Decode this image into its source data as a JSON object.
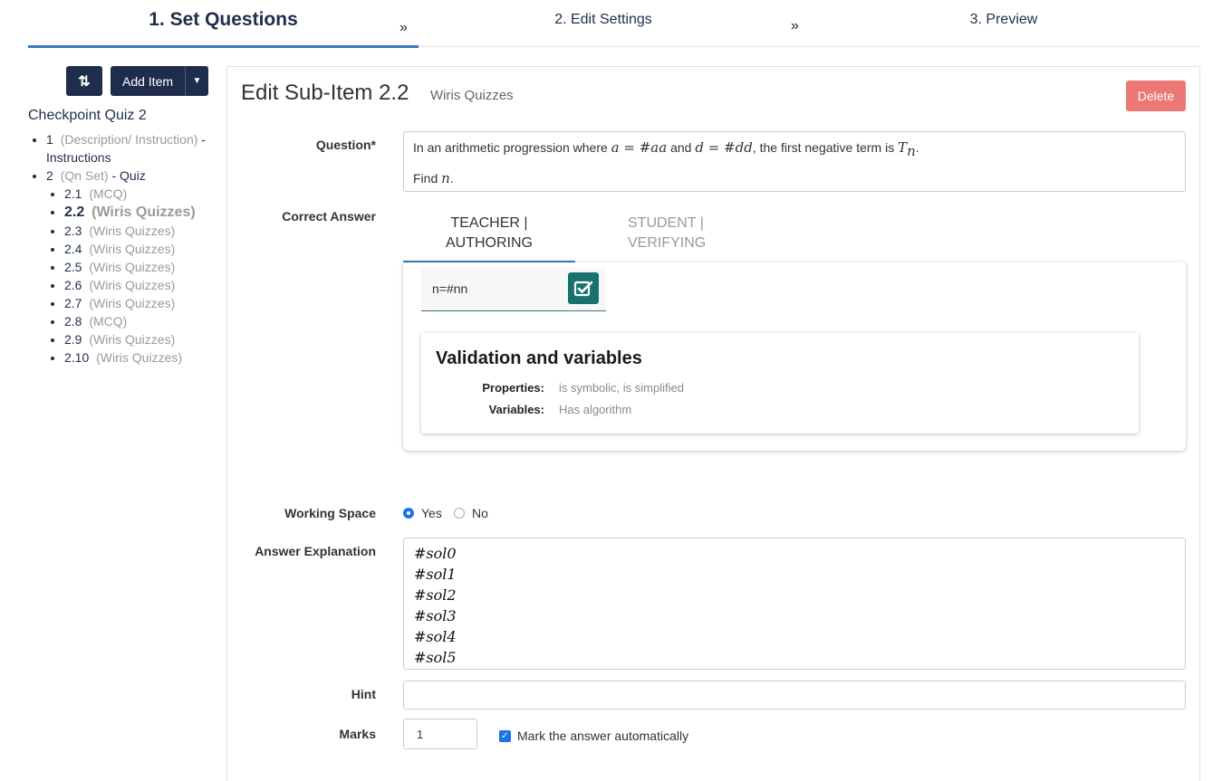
{
  "steps": [
    {
      "label": "1. Set Questions"
    },
    {
      "label": "2. Edit Settings"
    },
    {
      "label": "3. Preview"
    }
  ],
  "step_separator": "»",
  "sidebar": {
    "sort_icon": "sort-arrows-icon",
    "sort_glyph": "⇅",
    "add_item_label": "Add Item",
    "quiz_title": "Checkpoint Quiz 2",
    "items": [
      {
        "num": "1",
        "type": "(Description/ Instruction)",
        "suffix": "- Instructions"
      },
      {
        "num": "2",
        "type": "(Qn Set)",
        "suffix": "- Quiz"
      }
    ],
    "sub_items": [
      {
        "num": "2.1",
        "type": "(MCQ)"
      },
      {
        "num": "2.2",
        "type": "(Wiris Quizzes)"
      },
      {
        "num": "2.3",
        "type": "(Wiris Quizzes)"
      },
      {
        "num": "2.4",
        "type": "(Wiris Quizzes)"
      },
      {
        "num": "2.5",
        "type": "(Wiris Quizzes)"
      },
      {
        "num": "2.6",
        "type": "(Wiris Quizzes)"
      },
      {
        "num": "2.7",
        "type": "(Wiris Quizzes)"
      },
      {
        "num": "2.8",
        "type": "(MCQ)"
      },
      {
        "num": "2.9",
        "type": "(Wiris Quizzes)"
      },
      {
        "num": "2.10",
        "type": "(Wiris Quizzes)"
      }
    ]
  },
  "editor": {
    "title": "Edit Sub-Item 2.2",
    "subtitle": "Wiris Quizzes",
    "delete_label": "Delete",
    "question_label": "Question*",
    "question": {
      "t1": "In an arithmetic progression where ",
      "m1": "a = #aa",
      "t2": " and ",
      "m2": "d = #dd",
      "t3": ", the first negative term is ",
      "m3": "T",
      "m3_sub": "n",
      "t4": ".",
      "line2_text": "Find ",
      "line2_math": "n",
      "line2_end": "."
    },
    "correct_answer_label": "Correct Answer",
    "tabs": {
      "teacher_l1": "TEACHER |",
      "teacher_l2": "AUTHORING",
      "student_l1": "STUDENT |",
      "student_l2": "VERIFYING"
    },
    "answer_value": "n=#nn",
    "validation": {
      "title": "Validation and variables",
      "properties_label": "Properties:",
      "properties_value": "is symbolic, is simplified",
      "variables_label": "Variables:",
      "variables_value": "Has algorithm"
    },
    "working_space_label": "Working Space",
    "working_space_yes": "Yes",
    "working_space_no": "No",
    "working_space_selected": "Yes",
    "answer_explanation_label": "Answer Explanation",
    "explanation_lines": [
      "#sol0",
      "#sol1",
      "#sol2",
      "#sol3",
      "#sol4",
      "#sol5"
    ],
    "hint_label": "Hint",
    "hint_value": "",
    "marks_label": "Marks",
    "marks_value": "1",
    "auto_mark_label": "Mark the answer automatically",
    "auto_mark_checked": true
  },
  "colors": {
    "navy": "#1f2d4d",
    "accent_blue": "#3d7ab8",
    "delete_red": "#ec7775",
    "teal": "#17716f"
  }
}
